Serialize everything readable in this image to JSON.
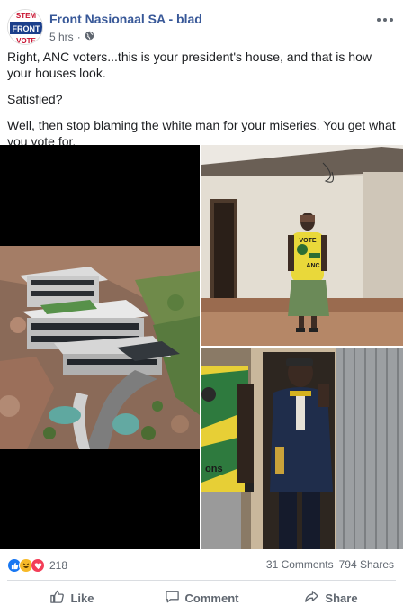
{
  "post": {
    "author": "Front Nasionaal SA - blad",
    "time": "5 hrs",
    "time_separator": "·",
    "avatar": {
      "top_text": "STEM",
      "mid_text": "FRONT",
      "bottom_text": "VOTE"
    },
    "more_icon": "more-options-icon",
    "privacy_icon": "globe-icon",
    "text": {
      "p1": "Right, ANC voters...this is your president's house, and that is how your houses look.",
      "p2": "Satisfied?",
      "p3": "Well, then stop blaming the white man for your miseries. You get what you vote for."
    },
    "photos": {
      "main_label": "aerial-view-of-luxury-house",
      "top_right_label": "woman-in-anc-shirt-outside-hut",
      "bottom_right_label": "man-in-doorway-of-shack",
      "shirt_text_1": "VOTE",
      "shirt_text_2": "ANC",
      "shirt_text_3": "ons"
    },
    "reactions": {
      "icons": [
        "like-icon",
        "haha-icon",
        "love-icon"
      ],
      "count": "218",
      "comments": "31 Comments",
      "shares": "794 Shares"
    },
    "actions": {
      "like": "Like",
      "comment": "Comment",
      "share": "Share"
    }
  },
  "colors": {
    "link": "#385898",
    "secondary_text": "#606770",
    "like_blue": "#1877f2",
    "love_red": "#f33e58",
    "haha_yellow": "#f7b928"
  }
}
